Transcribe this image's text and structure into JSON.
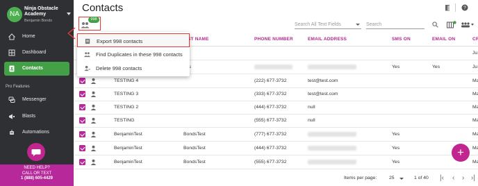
{
  "sidebar": {
    "brand": {
      "avatar": "NA",
      "name": "Ninja Obstacle Academy",
      "user": "Benjamin Bonds"
    },
    "items": [
      {
        "label": "Home",
        "icon": "home-icon"
      },
      {
        "label": "Dashboard",
        "icon": "dashboard-icon"
      },
      {
        "label": "Contacts",
        "icon": "contacts-icon",
        "active": true
      }
    ],
    "section_label": "Pro Features",
    "pro_items": [
      {
        "label": "Messenger",
        "icon": "messenger-icon"
      },
      {
        "label": "Blasts",
        "icon": "megaphone-icon"
      },
      {
        "label": "Automations",
        "icon": "robot-icon"
      }
    ],
    "help": {
      "line1": "NEED HELP?",
      "line2": "CALL OR TEXT",
      "phone": "1 (888) 605-4429"
    }
  },
  "header": {
    "title": "Contacts"
  },
  "toolbar": {
    "selected_count": "998",
    "search_all_placeholder": "Search All Text Fields",
    "search_placeholder": "Search"
  },
  "menu": {
    "items": [
      {
        "label": "Export 998 contacts",
        "icon": "export-icon",
        "highlighted": true
      },
      {
        "label": "Find Duplicates in these 998 contacts",
        "icon": "duplicates-icon"
      },
      {
        "label": "Delete 998 contacts",
        "icon": "delete-contacts-icon"
      }
    ]
  },
  "table": {
    "columns": [
      "ST NAME",
      "PHONE NUMBER",
      "EMAIL ADDRESS",
      "SMS ON",
      "EMAIL ON",
      "CR"
    ],
    "rows": [
      {
        "first": "",
        "last": "",
        "phone": "",
        "email": "",
        "sms": "",
        "emailon": "",
        "cr": "Ju"
      },
      {
        "first": "",
        "last": "nds",
        "phone": "",
        "email": "",
        "sms": "Yes",
        "emailon": "Yes",
        "cr": "Ju"
      },
      {
        "first": "TESTING 4",
        "last": "",
        "phone": "(222) 677-3732",
        "email": "test@test.com",
        "sms": "",
        "emailon": "",
        "cr": "Ma"
      },
      {
        "first": "TESTING 3",
        "last": "",
        "phone": "(333) 677-3732",
        "email": "test@test.com",
        "sms": "",
        "emailon": "",
        "cr": "Ma"
      },
      {
        "first": "TESTING 2",
        "last": "",
        "phone": "(444) 677-3732",
        "email": "null",
        "sms": "",
        "emailon": "",
        "cr": "Ma"
      },
      {
        "first": "TESTING",
        "last": "",
        "phone": "(555) 677-3732",
        "email": "null",
        "sms": "",
        "emailon": "",
        "cr": "Ma"
      },
      {
        "first": "BenjaminTest",
        "last": "BondsTest",
        "phone": "(777) 677-3732",
        "email": "",
        "sms": "Yes",
        "emailon": "",
        "cr": "Ma"
      },
      {
        "first": "BenjaminTest",
        "last": "BondsTest",
        "phone": "(444) 677-3732",
        "email": "",
        "sms": "Yes",
        "emailon": "",
        "cr": "Ma"
      },
      {
        "first": "BenjaminTest",
        "last": "BondsTest",
        "phone": "(555) 677-3732",
        "email": "",
        "sms": "Yes",
        "emailon": "",
        "cr": "Ma"
      }
    ]
  },
  "footer": {
    "items_per_page_label": "Items per page:",
    "items_per_page": "25",
    "page_info": "1 of 40"
  },
  "colors": {
    "accent": "#b7289a",
    "active": "#43a047",
    "highlight": "#e53935"
  }
}
